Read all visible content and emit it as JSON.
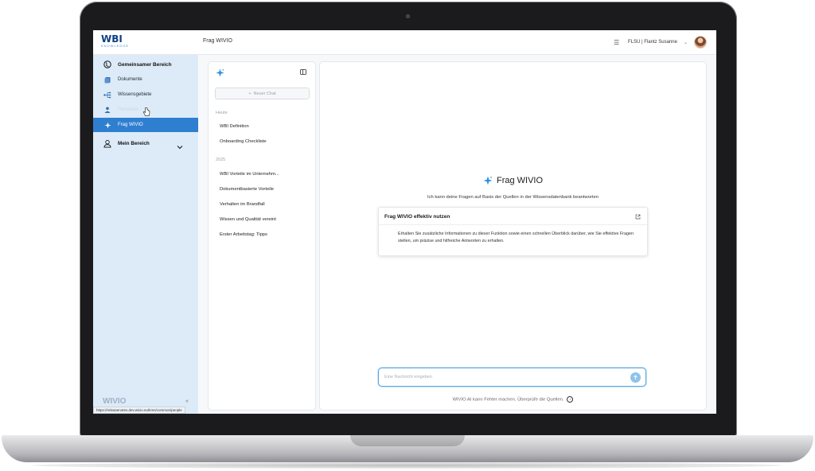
{
  "header": {
    "logo_text": "WBI",
    "logo_tagline": "KNOWLEDGE",
    "page_title": "Frag WIVIO",
    "user_label": "FLSU | Flantz Susanne",
    "user_chevron": "⌄"
  },
  "sidebar": {
    "items": [
      {
        "label": "Gemeinsamer Bereich",
        "icon": "globe-icon"
      },
      {
        "label": "Dokumente",
        "icon": "document-icon"
      },
      {
        "label": "Wissensgebiete",
        "icon": "tree-icon"
      },
      {
        "label": "Personen",
        "icon": "person-icon"
      },
      {
        "label": "Frag WIVIO",
        "icon": "sparkle-icon"
      },
      {
        "label": "Mein Bereich",
        "icon": "user-icon"
      }
    ],
    "footer_logo": "WIVIO",
    "collapse_glyph": "«",
    "status_url": "https://releasenotes.dev.wivio.eu/kms/common/people"
  },
  "history": {
    "new_chat_label": "Neuer Chat",
    "groups": [
      {
        "label": "Heute",
        "items": [
          "WBI Definition",
          "Onboarding Checkliste"
        ]
      },
      {
        "label": "2025",
        "items": [
          "WBI Vorteile im Unternehm...",
          "Dokumentbasierte Vorteile",
          "Verhalten im Brandfall",
          "Wissen und Qualität vereint",
          "Erster Arbeitstag: Tipps"
        ]
      }
    ]
  },
  "main": {
    "title": "Frag WIVIO",
    "subtitle": "Ich kann deine Fragen auf Basis der Quellen in der Wissensdatenbank beantworten",
    "card_title": "Frag WIVIO effektiv nutzen",
    "card_text": "Erhalten Sie zusätzliche Informationen zu dieser Funktion sowie einen schnellen Überblick darüber, wie Sie effektive Fragen stellen, um präzise und hilfreiche Antworten zu erhalten.",
    "input_placeholder": "Eine Nachricht eingeben",
    "disclaimer": "WIVIO AI kann Fehler machen. Überprüfe die Quellen."
  },
  "colors": {
    "accent": "#2f7fd0",
    "sidebar_bg": "#dcebf7",
    "brand": "#0e3f82"
  }
}
